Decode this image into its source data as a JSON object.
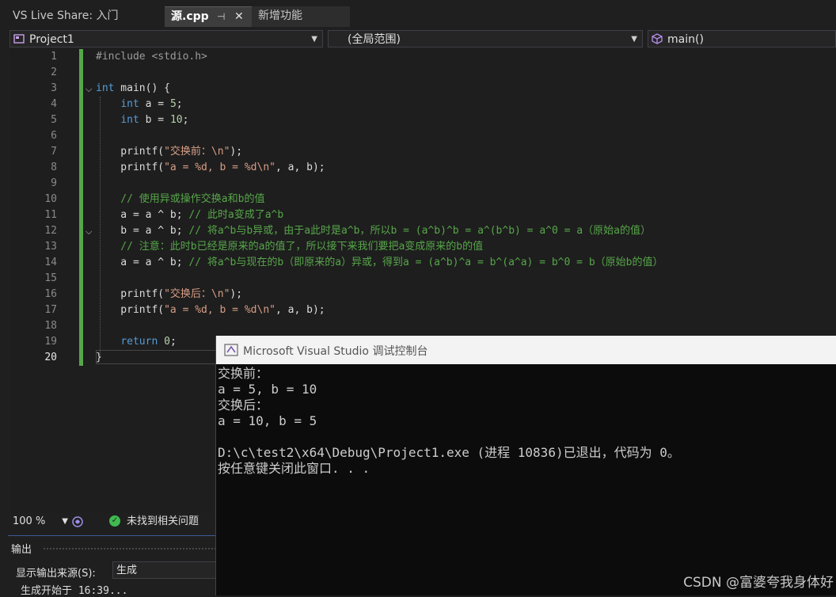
{
  "tabs": [
    {
      "label": "VS Live Share: 入门"
    },
    {
      "label": "源.cpp",
      "pin": "⊣",
      "close": "✕"
    },
    {
      "label": "新增功能"
    }
  ],
  "navbar": {
    "project": "Project1",
    "scope": "(全局范围)",
    "member": "main()"
  },
  "editor": {
    "line_numbers": [
      "1",
      "2",
      "3",
      "4",
      "5",
      "6",
      "7",
      "8",
      "9",
      "10",
      "11",
      "12",
      "13",
      "14",
      "15",
      "16",
      "17",
      "18",
      "19",
      "20"
    ],
    "lines": [
      "#include <stdio.h>",
      "",
      "int main() {",
      "    int a = 5;",
      "    int b = 10;",
      "",
      "    printf(\"交换前：\\n\");",
      "    printf(\"a = %d, b = %d\\n\", a, b);",
      "",
      "    // 使用异或操作交换a和b的值",
      "    a = a ^ b; // 此时a变成了a^b",
      "    b = a ^ b; // 将a^b与b异或，由于a此时是a^b，所以b = (a^b)^b = a^(b^b) = a^0 = a（原始a的值）",
      "    // 注意：此时b已经是原来的a的值了，所以接下来我们要把a变成原来的b的值",
      "    a = a ^ b; // 将a^b与现在的b（即原来的a）异或，得到a = (a^b)^a = b^(a^a) = b^0 = b（原始b的值）",
      "",
      "    printf(\"交换后：\\n\");",
      "    printf(\"a = %d, b = %d\\n\", a, b);",
      "",
      "    return 0;",
      "}"
    ]
  },
  "status": {
    "zoom": "100 %",
    "issues": "未找到相关问题"
  },
  "output": {
    "title": "输出",
    "source_label": "显示输出来源(S):",
    "source_value": "生成",
    "first_line": "生成开始于 16:39..."
  },
  "console": {
    "title": "Microsoft Visual Studio 调试控制台",
    "lines": [
      "交换前：",
      "a = 5, b = 10",
      "交换后：",
      "a = 10, b = 5",
      "",
      "D:\\c\\test2\\x64\\Debug\\Project1.exe (进程 10836)已退出，代码为 0。",
      "按任意键关闭此窗口. . ."
    ]
  },
  "watermark": "CSDN @富婆夸我身体好",
  "colors": {
    "keyword": "#569cd6",
    "string": "#d69d85",
    "comment": "#57a64a",
    "change_bar": "#57a64a"
  }
}
